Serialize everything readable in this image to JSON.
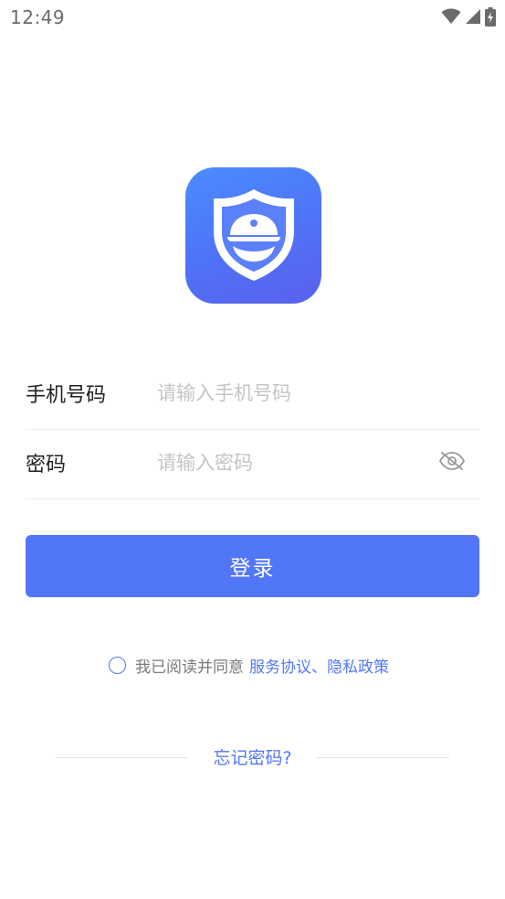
{
  "status_bar": {
    "time": "12:49",
    "icons": [
      "wifi-icon",
      "cellular-signal-icon",
      "battery-charging-icon"
    ]
  },
  "logo": {
    "icon": "police-shield-icon",
    "colors": {
      "gradient_start": "#4a8cff",
      "gradient_end": "#5a60ec"
    }
  },
  "form": {
    "phone": {
      "label": "手机号码",
      "placeholder": "请输入手机号码",
      "value": ""
    },
    "password": {
      "label": "密码",
      "placeholder": "请输入密码",
      "value": "",
      "visibility_icon": "eye-off-icon"
    }
  },
  "login_button": {
    "label": "登录"
  },
  "agreement": {
    "checked": false,
    "text": "我已阅读并同意",
    "link_text": "服务协议、隐私政策"
  },
  "forgot_password": {
    "label": "忘记密码?"
  },
  "colors": {
    "accent": "#5276f8",
    "label_text": "#222222",
    "placeholder_text": "#c4c4c4",
    "muted_text": "#7a7a7a",
    "divider": "#ececec"
  }
}
